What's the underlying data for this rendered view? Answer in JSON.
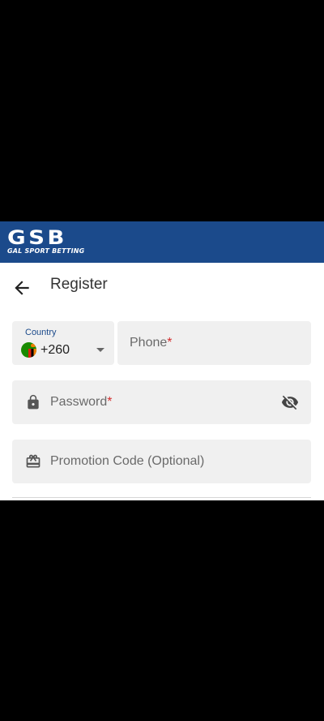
{
  "header": {
    "logo_main": "GSB",
    "logo_sub": "GAL SPORT BETTING",
    "brand_color": "#1b4a8b"
  },
  "page": {
    "title": "Register",
    "back_icon": "arrow-left-icon"
  },
  "form": {
    "country": {
      "label": "Country",
      "value": "+260",
      "flag": "zambia-flag-icon"
    },
    "phone": {
      "placeholder": "Phone",
      "required_mark": "*"
    },
    "password": {
      "placeholder": "Password",
      "required_mark": "*",
      "lead_icon": "lock-icon",
      "toggle_icon": "eye-off-icon"
    },
    "promo": {
      "placeholder": "Promotion Code (Optional)",
      "lead_icon": "gift-icon"
    }
  },
  "colors": {
    "field_bg": "#f0f0f0",
    "required": "#d32f2f",
    "label_accent": "#1b4a8b"
  }
}
